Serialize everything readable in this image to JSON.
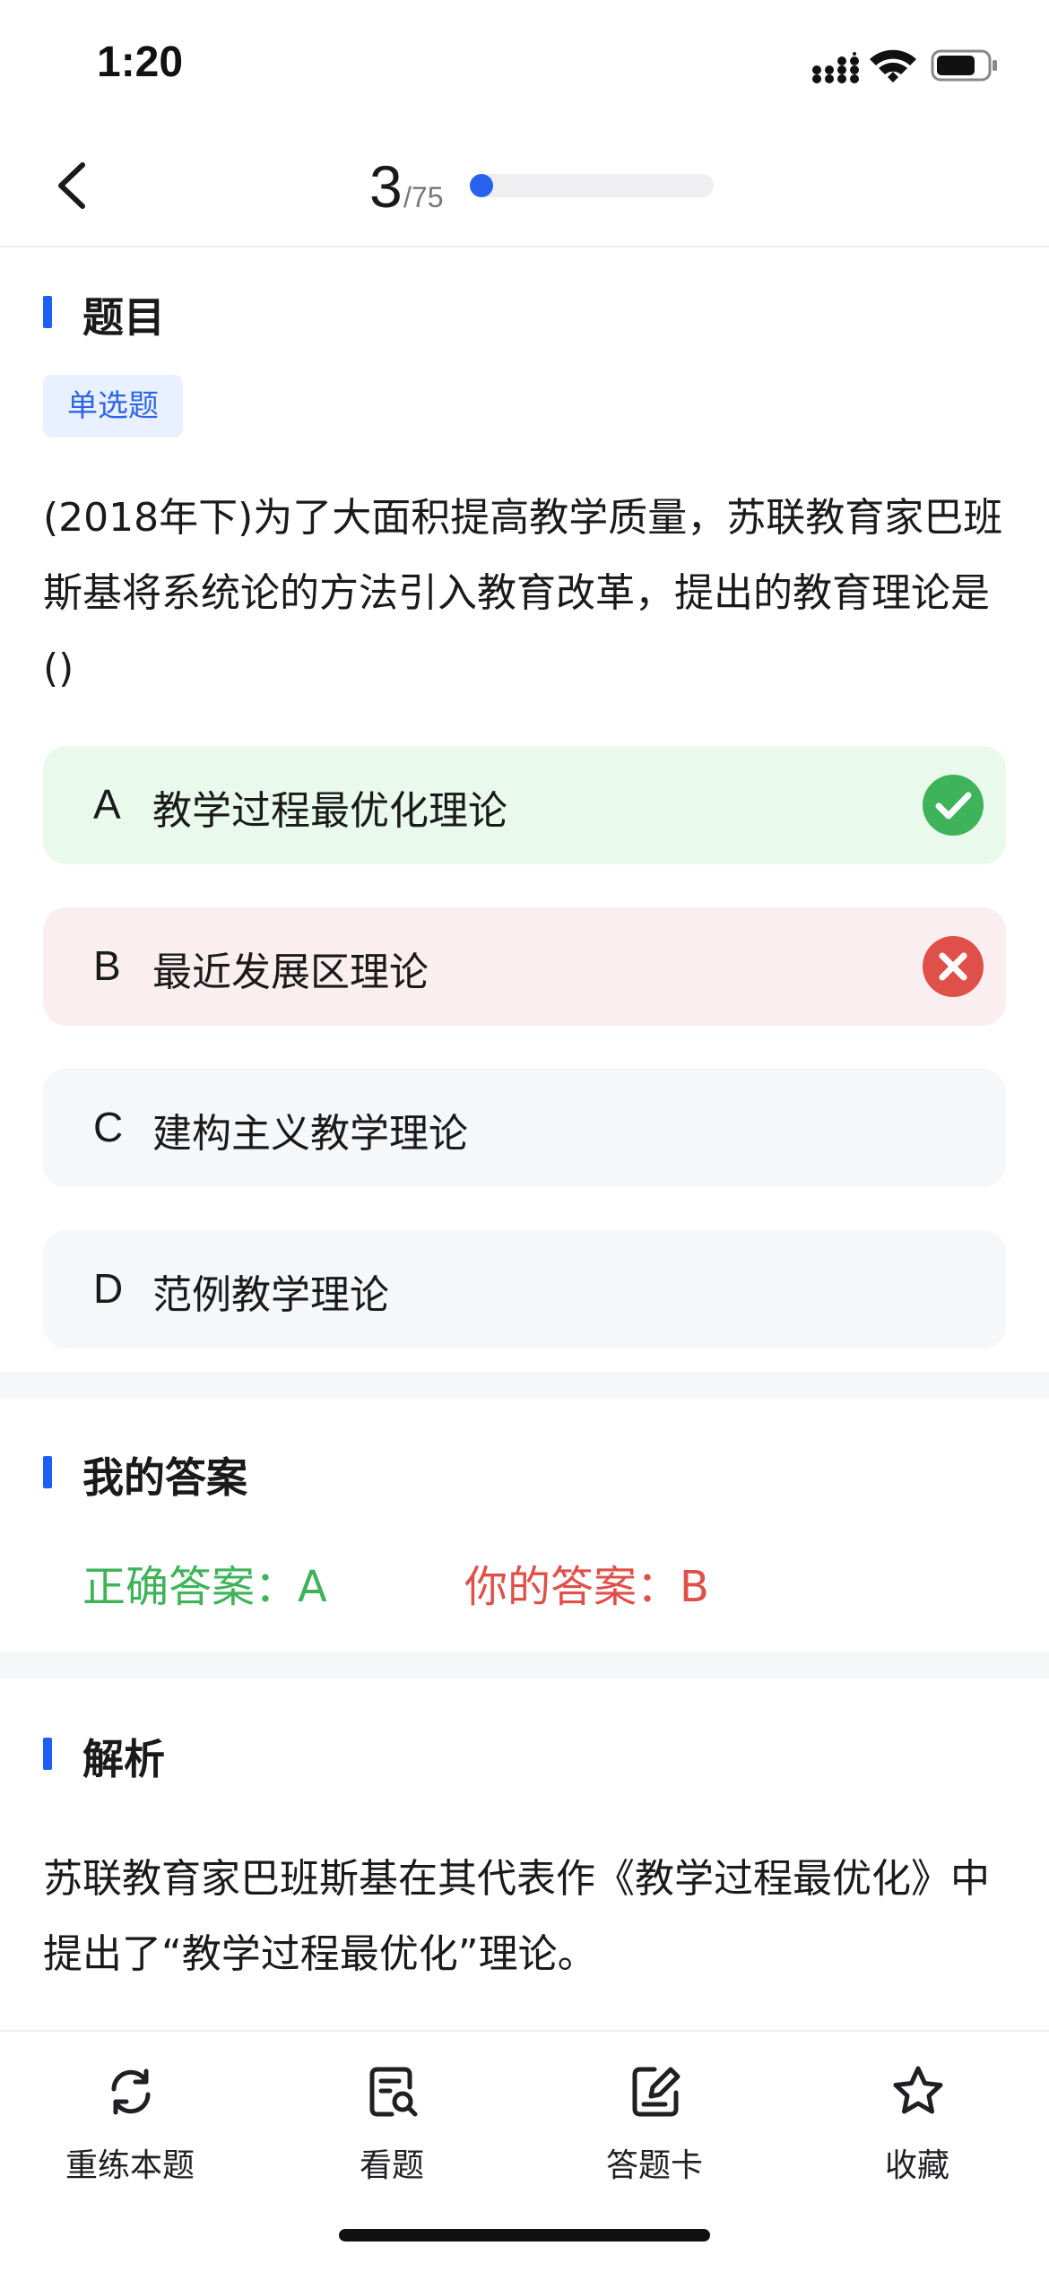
{
  "status_bar": {
    "time": "1:20"
  },
  "header": {
    "current": "3",
    "total": "/75",
    "progress_fraction": 0.04
  },
  "question_section": {
    "title": "题目",
    "type_badge": "单选题"
  },
  "question": {
    "text": "(2018年下)为了大面积提高教学质量，苏联教育家巴班斯基将系统论的方法引入教育改革，提出的教育理论是()"
  },
  "options": [
    {
      "letter": "A",
      "text": "教学过程最优化理论",
      "state": "correct"
    },
    {
      "letter": "B",
      "text": "最近发展区理论",
      "state": "wrong"
    },
    {
      "letter": "C",
      "text": "建构主义教学理论",
      "state": "none"
    },
    {
      "letter": "D",
      "text": "范例教学理论",
      "state": "none"
    }
  ],
  "answer_section": {
    "title": "我的答案",
    "correct_label": "正确答案：A",
    "mine_label": "你的答案：B"
  },
  "analysis_section": {
    "title": "解析",
    "text": "苏联教育家巴班斯基在其代表作《教学过程最优化》中提出了“教学过程最优化”理论。"
  },
  "bottom_tabs": [
    {
      "label": "重练本题",
      "icon": "refresh-icon"
    },
    {
      "label": "看题",
      "icon": "view-question-icon"
    },
    {
      "label": "答题卡",
      "icon": "answer-sheet-icon"
    },
    {
      "label": "收藏",
      "icon": "star-icon"
    }
  ],
  "colors": {
    "accent": "#2a62f0",
    "correct": "#3fb35a",
    "wrong": "#e0504a",
    "correct_bg": "#e9f9ec",
    "wrong_bg": "#fbeef0"
  }
}
